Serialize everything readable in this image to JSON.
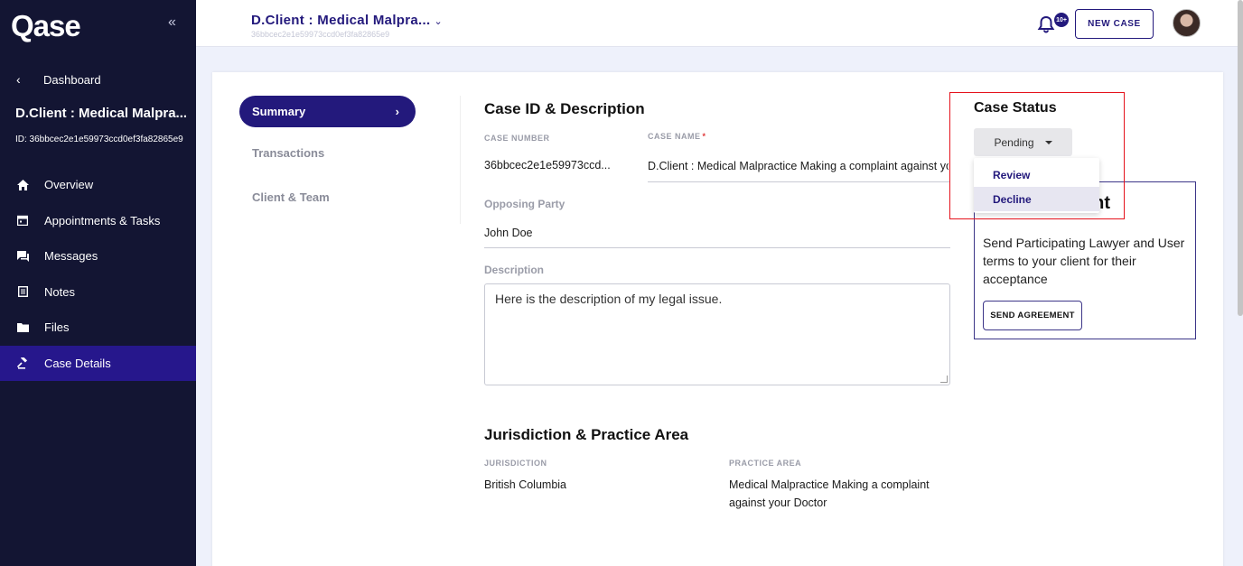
{
  "sidebar": {
    "logo": "Qase",
    "collapse_icon": "«",
    "dashboard_label": "Dashboard",
    "case_title": "D.Client : Medical Malpra...",
    "case_id": "ID: 36bbcec2e1e59973ccd0ef3fa82865e9",
    "items": [
      {
        "label": "Overview",
        "icon": "home-icon"
      },
      {
        "label": "Appointments & Tasks",
        "icon": "calendar-icon"
      },
      {
        "label": "Messages",
        "icon": "chat-icon"
      },
      {
        "label": "Notes",
        "icon": "notes-icon"
      },
      {
        "label": "Files",
        "icon": "folder-icon"
      },
      {
        "label": "Case Details",
        "icon": "gavel-icon",
        "active": true
      }
    ]
  },
  "header": {
    "case_select": "D.Client : Medical Malpra...",
    "case_sub": "36bbcec2e1e59973ccd0ef3fa82865e9",
    "notification_badge": "10+",
    "new_case_label": "NEW CASE"
  },
  "tabs": {
    "active": "Summary",
    "active_chevron": "›",
    "others": [
      "Transactions",
      "Client & Team"
    ]
  },
  "case_section": {
    "title": "Case ID & Description",
    "case_number_label": "CASE NUMBER",
    "case_number_value": "36bbcec2e1e59973ccd...",
    "case_name_label": "CASE NAME",
    "case_name_required": "*",
    "case_name_value": "D.Client : Medical Malpractice Making a complaint against you",
    "opposing_party_label": "Opposing Party",
    "opposing_party_value": "John Doe",
    "description_label": "Description",
    "description_value": "Here is the description of my legal issue."
  },
  "jurisdiction_section": {
    "title": "Jurisdiction & Practice Area",
    "jurisdiction_label": "JURISDICTION",
    "jurisdiction_value": "British Columbia",
    "practice_area_label": "PRACTICE AREA",
    "practice_area_value": "Medical Malpractice Making a complaint against your Doctor"
  },
  "case_status": {
    "title": "Case Status",
    "selected": "Pending",
    "options": [
      "Review",
      "Decline"
    ],
    "highlighted_option": "Decline"
  },
  "agreement": {
    "title_visible": "ent",
    "text": "Send Participating Lawyer and User terms to your client for their acceptance",
    "button_label": "SEND AGREEMENT"
  }
}
